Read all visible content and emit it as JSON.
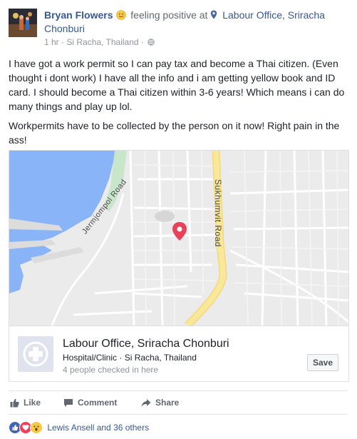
{
  "post": {
    "author": "Bryan Flowers",
    "feeling": "feeling positive at",
    "place": "Labour Office, Sriracha Chonburi",
    "meta": {
      "time": "1 hr",
      "separator": "·",
      "location": "Si Racha, Thailand",
      "dot": "·"
    },
    "paragraphs": [
      "I have got a work permit so I can pay tax and become a Thai citizen. (Even thought i dont work) I have all the info and i am getting yellow book and ID card. I should become a Thai citizen within 3-6 years! Which means i can do many things and play up lol.",
      "Workpermits have to be collected by the person on it now! Right pain in the ass!"
    ]
  },
  "map": {
    "roads": {
      "sukhumvit": "Sukhumvit Road",
      "jermjompol": "Jermjompol Road"
    },
    "colors": {
      "water": "#8ab4f8",
      "land": "#ebebeb",
      "park": "#c8e6c9",
      "major_road": "#f9e79a",
      "pin": "#e8415a"
    }
  },
  "place_card": {
    "title": "Labour Office, Sriracha Chonburi",
    "category": "Hospital/Clinic · Si Racha, Thailand",
    "checkins": "4 people checked in here",
    "save_label": "Save",
    "icon": "hospital-cross-icon"
  },
  "actions": {
    "like": "Like",
    "comment": "Comment",
    "share": "Share"
  },
  "reactions": {
    "icons": [
      "like-reaction-icon",
      "love-reaction-icon",
      "wow-reaction-icon"
    ],
    "text": "Lewis Ansell and 36 others"
  },
  "colors": {
    "link": "#365899",
    "text": "#1d2129",
    "meta": "#90949c"
  }
}
